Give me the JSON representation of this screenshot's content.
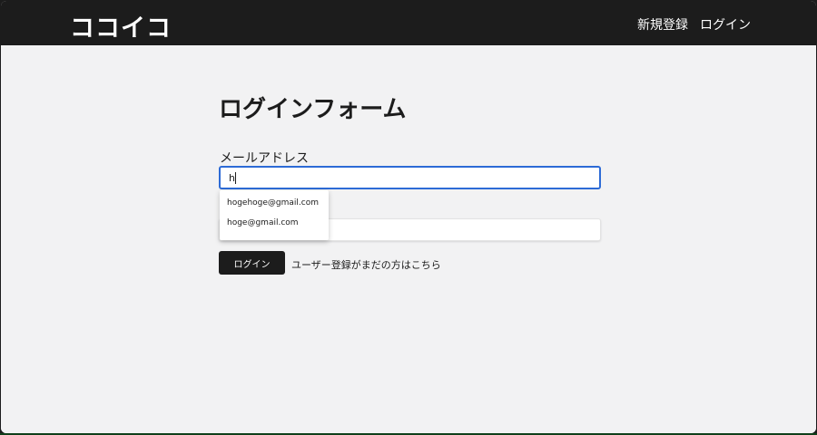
{
  "header": {
    "brand": "ココイコ",
    "links": [
      {
        "label": "新規登録"
      },
      {
        "label": "ログイン"
      }
    ]
  },
  "form": {
    "title": "ログインフォーム",
    "email_label": "メールアドレス",
    "email_value": "h",
    "autocomplete": [
      "hogehoge@gmail.com",
      "hoge@gmail.com"
    ],
    "login_button": "ログイン",
    "register_link": "ユーザー登録がまだの方はこちら"
  },
  "colors": {
    "header_bg": "#1c1c1c",
    "page_bg": "#f2f2f3",
    "focus_border": "#2d6bd6",
    "button_bg": "#1c1c1c"
  }
}
